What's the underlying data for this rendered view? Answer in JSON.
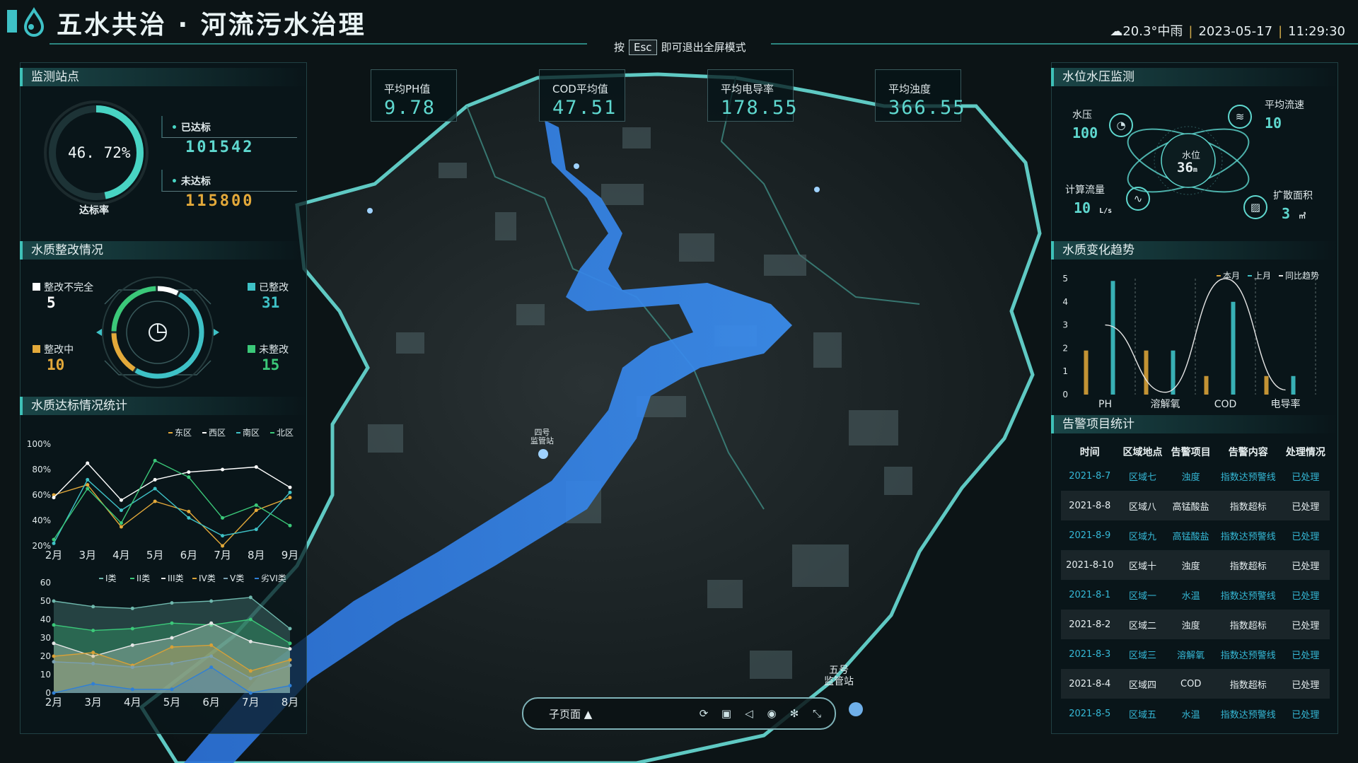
{
  "header": {
    "title": "五水共治 · 河流污水治理",
    "weather": "20.3°中雨",
    "date": "2023-05-17",
    "time": "11:29:30"
  },
  "esc_hint": {
    "prefix": "按",
    "key": "Esc",
    "suffix": "即可退出全屏模式"
  },
  "metrics": [
    {
      "label": "平均PH值",
      "value": "9.78"
    },
    {
      "label": "COD平均值",
      "value": "47.51"
    },
    {
      "label": "平均电导率",
      "value": "178.55"
    },
    {
      "label": "平均浊度",
      "value": "366.55"
    }
  ],
  "stations": {
    "title": "监测站点",
    "rate": "46. 72%",
    "rate_value": 46.72,
    "rate_label": "达标率",
    "passed_label": "已达标",
    "passed_value": "101542",
    "failed_label": "未达标",
    "failed_value": "115800"
  },
  "rectify": {
    "title": "水质整改情况",
    "items": [
      {
        "label": "整改不完全",
        "value": "5",
        "color": "#ffffff"
      },
      {
        "label": "已整改",
        "value": "31",
        "color": "#3ec1c6"
      },
      {
        "label": "整改中",
        "value": "10",
        "color": "#e3a93a"
      },
      {
        "label": "未整改",
        "value": "15",
        "color": "#3bc879"
      }
    ]
  },
  "compliance": {
    "title": "水质达标情况统计",
    "chart_data": [
      {
        "type": "line",
        "categories": [
          "2月",
          "3月",
          "4月",
          "5月",
          "6月",
          "7月",
          "8月",
          "9月"
        ],
        "ylim": [
          20,
          100
        ],
        "yticks": [
          "20%",
          "40%",
          "60%",
          "80%",
          "100%"
        ],
        "series": [
          {
            "name": "东区",
            "color": "#e3a93a",
            "values": [
              60,
              68,
              35,
              55,
              47,
              20,
              48,
              58
            ]
          },
          {
            "name": "西区",
            "color": "#ffffff",
            "values": [
              58,
              85,
              56,
              72,
              78,
              80,
              82,
              66
            ]
          },
          {
            "name": "南区",
            "color": "#3ec1c6",
            "values": [
              22,
              72,
              48,
              65,
              42,
              28,
              33,
              62
            ]
          },
          {
            "name": "北区",
            "color": "#3bc879",
            "values": [
              25,
              65,
              38,
              87,
              74,
              42,
              52,
              36
            ]
          }
        ]
      },
      {
        "type": "area",
        "categories": [
          "2月",
          "3月",
          "4月",
          "5月",
          "6月",
          "7月",
          "8月"
        ],
        "ylim": [
          0,
          60
        ],
        "yticks": [
          "0",
          "10",
          "20",
          "30",
          "40",
          "50",
          "60"
        ],
        "series": [
          {
            "name": "I类",
            "color": "#6fb8ad",
            "values": [
              50,
              47,
              46,
              49,
              50,
              52,
              35
            ]
          },
          {
            "name": "II类",
            "color": "#3bc879",
            "values": [
              37,
              34,
              35,
              38,
              37,
              40,
              27
            ]
          },
          {
            "name": "III类",
            "color": "#e6e6e6",
            "values": [
              27,
              20,
              26,
              30,
              38,
              28,
              24
            ]
          },
          {
            "name": "IV类",
            "color": "#d8a137",
            "values": [
              20,
              22,
              15,
              25,
              26,
              12,
              18
            ]
          },
          {
            "name": "V类",
            "color": "#7aa0b0",
            "values": [
              17,
              16,
              14,
              16,
              20,
              8,
              15
            ]
          },
          {
            "name": "劣VI类",
            "color": "#2f7fd6",
            "values": [
              0,
              5,
              2,
              2,
              14,
              0,
              4
            ]
          }
        ]
      }
    ]
  },
  "pressure": {
    "title": "水位水压监测",
    "water_pressure_label": "水压",
    "water_pressure_value": "100",
    "avg_flow_label": "平均流速",
    "avg_flow_value": "10",
    "water_level_label": "水位",
    "water_level_value": "36",
    "water_level_unit": "m",
    "calc_flow_label": "计算流量",
    "calc_flow_value": "10",
    "calc_flow_unit": "L/s",
    "spread_label": "扩散面积",
    "spread_value": "3",
    "spread_unit": "㎡"
  },
  "trend": {
    "title": "水质变化趋势",
    "chart_data": {
      "type": "bar",
      "categories": [
        "PH",
        "溶解氧",
        "COD",
        "电导率"
      ],
      "ylim": [
        0,
        5
      ],
      "yticks": [
        "0",
        "1",
        "2",
        "3",
        "4",
        "5"
      ],
      "series": [
        {
          "name": "本月",
          "color": "#d8a137",
          "values": [
            1.9,
            1.9,
            0.8,
            0.8
          ]
        },
        {
          "name": "上月",
          "color": "#3ec1c6",
          "values": [
            4.9,
            1.9,
            4.0,
            0.8
          ]
        },
        {
          "name": "同比趋势",
          "color": "#e6e6e6",
          "type": "line",
          "values": [
            3.0,
            0.1,
            5.0,
            0.2
          ]
        }
      ]
    }
  },
  "alerts": {
    "title": "告警项目统计",
    "headers": [
      "时间",
      "区域地点",
      "告警项目",
      "告警内容",
      "处理情况"
    ],
    "rows": [
      [
        "2021-8-7",
        "区域七",
        "浊度",
        "指数达预警线",
        "已处理"
      ],
      [
        "2021-8-8",
        "区域八",
        "高锰酸盐",
        "指数超标",
        "已处理"
      ],
      [
        "2021-8-9",
        "区域九",
        "高锰酸盐",
        "指数达预警线",
        "已处理"
      ],
      [
        "2021-8-10",
        "区域十",
        "浊度",
        "指数超标",
        "已处理"
      ],
      [
        "2021-8-1",
        "区域一",
        "水温",
        "指数达预警线",
        "已处理"
      ],
      [
        "2021-8-2",
        "区域二",
        "浊度",
        "指数超标",
        "已处理"
      ],
      [
        "2021-8-3",
        "区域三",
        "溶解氧",
        "指数达预警线",
        "已处理"
      ],
      [
        "2021-8-4",
        "区域四",
        "COD",
        "指数超标",
        "已处理"
      ],
      [
        "2021-8-5",
        "区域五",
        "水温",
        "指数达预警线",
        "已处理"
      ]
    ]
  },
  "map_labels": {
    "station4": "四号\n监管站",
    "station5": "五号\n监管站"
  },
  "toolbar": {
    "sub_label": "子页面 ▲"
  },
  "colors": {
    "accent": "#3ec1c6",
    "river": "#2f7fe0",
    "border": "#7fd0cf"
  }
}
